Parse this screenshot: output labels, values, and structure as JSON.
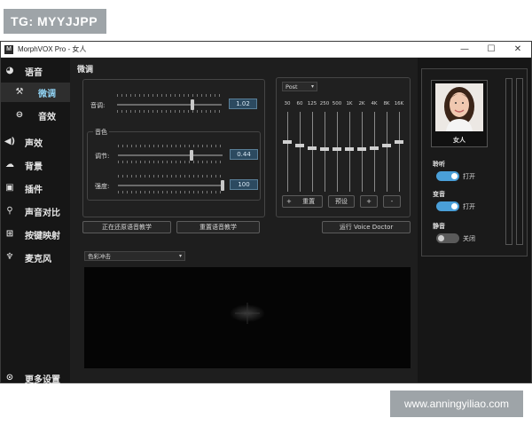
{
  "watermark_top": "TG: MYYJJPP",
  "watermark_bottom": "www.anningyiliao.com",
  "window": {
    "title": "MorphVOX Pro - 女人",
    "logo": "M",
    "minimize": "—",
    "maximize": "☐",
    "close": "✕"
  },
  "sidebar": {
    "items": [
      {
        "label": "语音",
        "icon": "speech-icon"
      },
      {
        "label": "微调",
        "icon": "tools-icon"
      },
      {
        "label": "音效",
        "icon": "effect-icon"
      },
      {
        "label": "声效",
        "icon": "speaker-icon"
      },
      {
        "label": "背景",
        "icon": "cloud-icon"
      },
      {
        "label": "插件",
        "icon": "plugin-icon"
      },
      {
        "label": "声音对比",
        "icon": "search-icon"
      },
      {
        "label": "按键映射",
        "icon": "keyboard-icon"
      },
      {
        "label": "麦克风",
        "icon": "mic-icon"
      },
      {
        "label": "更多设置",
        "icon": "more-icon"
      }
    ]
  },
  "tuning": {
    "title": "微调",
    "pitch_label": "音调:",
    "pitch_value": "1.02",
    "pitch_level": 0.72,
    "timbre_group": "音色",
    "shift_label": "调节:",
    "shift_value": "0.44",
    "shift_level": 0.7,
    "strength_label": "强度:",
    "strength_value": "100",
    "strength_level": 1.0,
    "btn_restore": "正在还原语音教学",
    "btn_reset": "重置语音教学"
  },
  "equalizer": {
    "preset": "Post",
    "bands": [
      "30",
      "60",
      "125",
      "250",
      "500",
      "1K",
      "2K",
      "4K",
      "8K",
      "16K"
    ],
    "levels": [
      0.38,
      0.42,
      0.45,
      0.47,
      0.47,
      0.47,
      0.47,
      0.45,
      0.42,
      0.38
    ],
    "btn_reset": "重置",
    "btn_reset_icon": "+",
    "btn_preset": "预设",
    "btn_add": "+",
    "btn_remove": "-",
    "btn_voice_doctor": "运行 Voice Doctor"
  },
  "visualizer": {
    "mode": "色彩冲击"
  },
  "voice_panel": {
    "name": "女人",
    "listen_label": "聆听",
    "listen_state": "打开",
    "morph_label": "变音",
    "morph_state": "打开",
    "mute_label": "静音",
    "mute_state": "关闭",
    "accent": "#4a9fd8"
  }
}
